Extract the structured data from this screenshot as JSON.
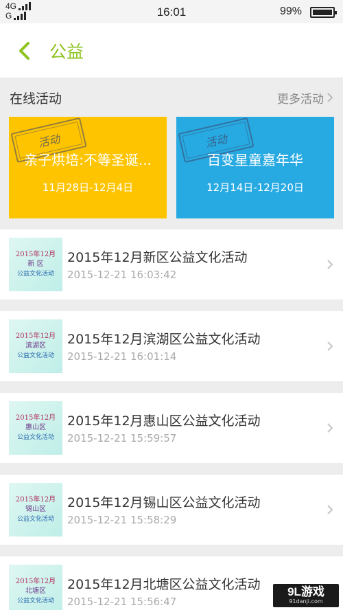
{
  "status_bar": {
    "network_top": "4G",
    "network_bottom": "G",
    "time": "16:01",
    "battery_percent_label": "99%",
    "battery_level": 0.99
  },
  "header": {
    "back_icon": "chevron-left-icon",
    "title": "公益",
    "accent_color": "#8dc21f"
  },
  "online_section": {
    "title": "在线活动",
    "more_label": "更多活动",
    "cards": [
      {
        "stamp": "活动",
        "title": "亲子烘培:不等圣诞...",
        "dates": "11月28日-12月4日",
        "color": "#ffc400"
      },
      {
        "stamp": "活动",
        "title": "百变星童嘉年华",
        "dates": "12月14日-12月20日",
        "color": "#27a9e1"
      }
    ]
  },
  "list": [
    {
      "thumb": [
        "2015年12月",
        "新 区",
        "公益文化活动"
      ],
      "title": "2015年12月新区公益文化活动",
      "time": "2015-12-21 16:03:42"
    },
    {
      "thumb": [
        "2015年12月",
        "滨湖区",
        "公益文化活动"
      ],
      "title": "2015年12月滨湖区公益文化活动",
      "time": "2015-12-21 16:01:14"
    },
    {
      "thumb": [
        "2015年12月",
        "惠山区",
        "公益文化活动"
      ],
      "title": "2015年12月惠山区公益文化活动",
      "time": "2015-12-21 15:59:57"
    },
    {
      "thumb": [
        "2015年12月",
        "锡山区",
        "公益文化活动"
      ],
      "title": "2015年12月锡山区公益文化活动",
      "time": "2015-12-21 15:58:29"
    },
    {
      "thumb": [
        "2015年12月",
        "北塘区",
        "公益文化活动"
      ],
      "title": "2015年12月北塘区公益文化活动",
      "time": "2015-12-21 15:56:47"
    }
  ],
  "watermark": {
    "logo": "9L游戏",
    "url": "91danji.com"
  }
}
